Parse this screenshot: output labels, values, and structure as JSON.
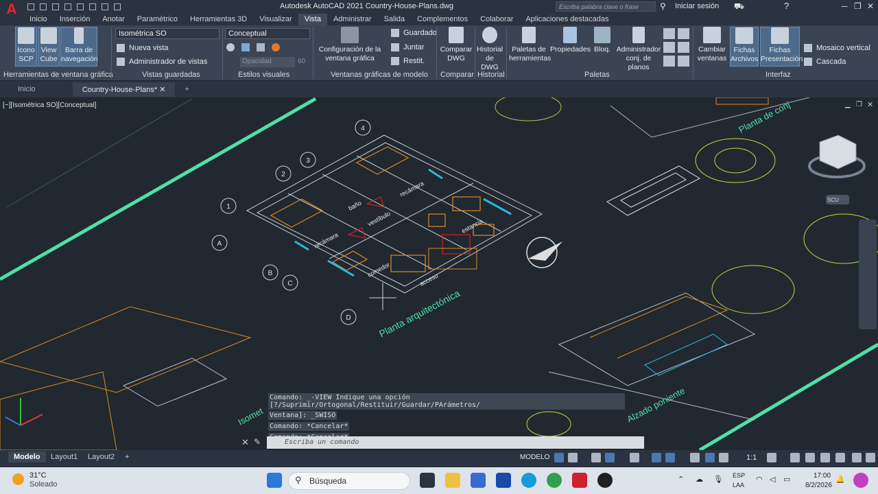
{
  "titlebar": {
    "logo": "A",
    "title": "Autodesk AutoCAD 2021    Country-House-Plans.dwg",
    "search_placeholder": "Escriba palabra clave o frase",
    "signin": "Iniciar sesión"
  },
  "menu": {
    "tabs": [
      "Inicio",
      "Inserción",
      "Anotar",
      "Paramétrico",
      "Herramientas 3D",
      "Visualizar",
      "Vista",
      "Administrar",
      "Salida",
      "Complementos",
      "Colaborar",
      "Aplicaciones destacadas"
    ],
    "active": "Vista"
  },
  "ribbon": {
    "viewport_tools": {
      "title": "Herramientas de ventana gráfica",
      "icono_scp": "Icono\nSCP",
      "view_cube": "View\nCube",
      "barra_nav": "Barra de\nnavegación"
    },
    "saved_views": {
      "title": "Vistas guardadas",
      "combo": "Isométrica SO",
      "nueva_vista": "Nueva vista",
      "admin_vistas": "Administrador de vistas"
    },
    "visual_styles": {
      "title": "Estilos visuales",
      "combo": "Conceptual",
      "opacity_label": "Opacidad",
      "opacity_value": "60"
    },
    "model_viewports": {
      "title": "Ventanas gráficas de modelo",
      "config": "Configuración de la\nventana gráfica",
      "guardado": "Guardado",
      "juntar": "Juntar",
      "restit": "Restit."
    },
    "compare": {
      "title": "Comparar",
      "btn": "Comparar\nDWG"
    },
    "history": {
      "title": "Historial",
      "btn": "Historial\nde DWG"
    },
    "palettes": {
      "title": "Paletas",
      "paletas_herr": "Paletas de\nherramientas",
      "propiedades": "Propiedades",
      "bloq": "Bloq.",
      "admin_planos": "Administrador\nconj. de planos"
    },
    "interface": {
      "title": "Interfaz",
      "cambiar": "Cambiar\nventanas",
      "fichas_archivos": "Fichas\nArchivos",
      "fichas_presentacion": "Fichas\nPresentación",
      "mosaico": "Mosaico vertical",
      "cascada": "Cascada"
    }
  },
  "doc_tabs": [
    "Inicio",
    "Country-House-Plans*"
  ],
  "viewport": {
    "label": "[−][Isométrica SO][Conceptual]",
    "labels": {
      "planta_arq": "Planta arquitectónica",
      "planta_conj": "Planta de conj",
      "alzado": "Alzado poniente",
      "isometrico": "Isomet",
      "recamara1": "recámara",
      "recamara2": "recámara",
      "bano": "baño",
      "vestibulo": "vestíbulo",
      "estancia": "estancia",
      "comedor": "comedor",
      "acceso": "acceso",
      "viewcube_tag": "SCU"
    },
    "grid_bubbles": [
      "1",
      "2",
      "3",
      "4",
      "A",
      "B",
      "C",
      "D"
    ]
  },
  "command": {
    "history": [
      "Comando: _-VIEW Indique una opción [?/Suprimir/Ortogonal/Restituir/Guardar/PArámetros/",
      "Ventana]: _SWISO",
      "Comando: *Cancelar*",
      "Comando: *Cancelar*"
    ],
    "placeholder": "Escriba un comando"
  },
  "layout_tabs": [
    "Modelo",
    "Layout1",
    "Layout2"
  ],
  "status": {
    "mode": "MODELO",
    "scale": "1:1"
  },
  "taskbar": {
    "temp": "31°C",
    "weather": "Soleado",
    "search": "Búsqueda",
    "lang1": "ESP",
    "lang2": "LAA",
    "time": "17:00",
    "date": "8/2/2026"
  },
  "colors": {
    "accent_green": "#4fe0a6",
    "orange": "#e08a20",
    "autocad_red": "#e0282e"
  }
}
